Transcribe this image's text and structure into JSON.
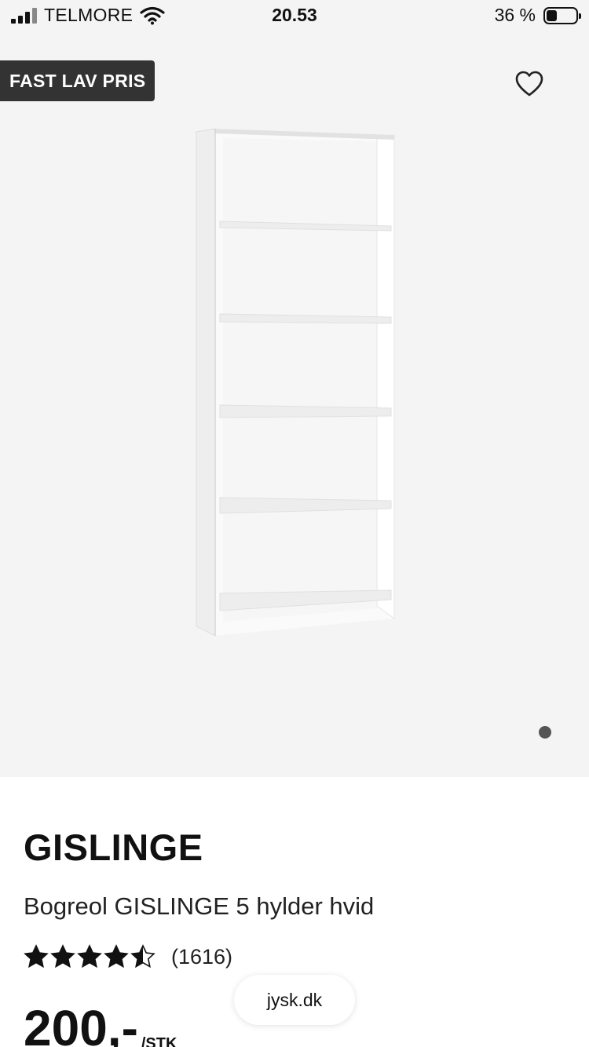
{
  "status_bar": {
    "carrier": "TELMORE",
    "time": "20.53",
    "battery_percent": "36 %",
    "battery_level": 0.36,
    "icons": [
      "signal-icon",
      "wifi-icon",
      "battery-icon"
    ]
  },
  "gallery": {
    "badge": "FAST LAV PRIS",
    "favorite_icon": "heart-icon",
    "image": "white bookshelf with 5 shelves",
    "page_indicator_active": 1
  },
  "product": {
    "name": "GISLINGE",
    "description": "Bogreol GISLINGE 5 hylder hvid",
    "rating": 4.5,
    "review_count": "(1616)",
    "price": "200,-",
    "price_unit": "/STK"
  },
  "browser": {
    "url": "jysk.dk"
  },
  "colors": {
    "badge_bg": "#333333",
    "gallery_bg": "#f4f4f4",
    "text": "#111111"
  }
}
